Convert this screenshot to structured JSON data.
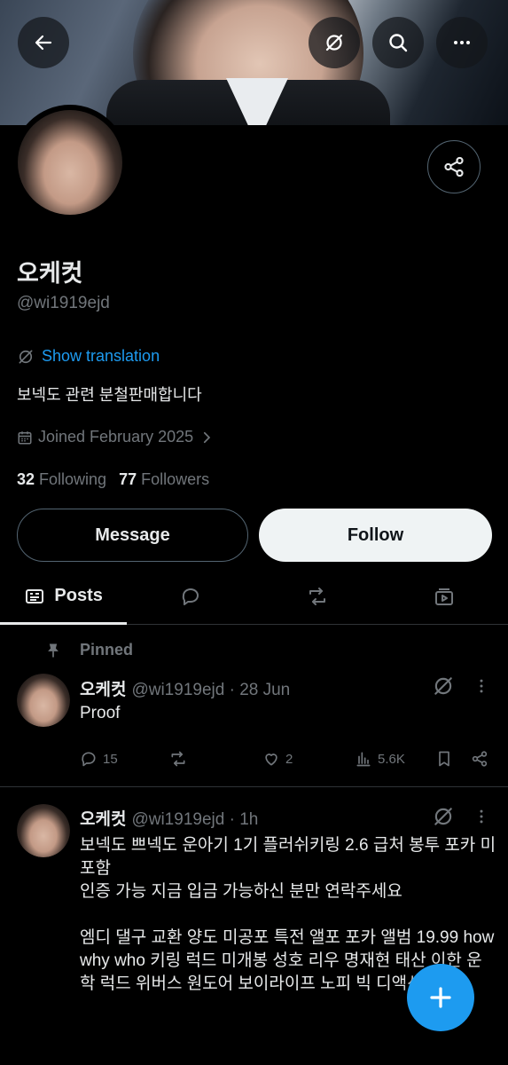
{
  "profile": {
    "name": "오케컷",
    "handle": "@wi1919ejd",
    "show_translation": "Show translation",
    "bio": "보넥도 관련 분철판매합니다",
    "joined": "Joined February 2025",
    "following_count": "32",
    "following_label": "Following",
    "followers_count": "77",
    "followers_label": "Followers"
  },
  "buttons": {
    "message": "Message",
    "follow": "Follow"
  },
  "tabs": {
    "posts": "Posts"
  },
  "pinned_label": "Pinned",
  "posts": [
    {
      "name": "오케컷",
      "meta": "@wi1919ejd · 28 Jun",
      "text": "Proof",
      "replies": "15",
      "reposts": "",
      "likes": "2",
      "views": "5.6K"
    },
    {
      "name": "오케컷",
      "meta": "@wi1919ejd · 1h",
      "text": "보넥도 쁘넥도 운아기 1기 플러쉬키링 2.6 급처 봉투 포카 미포함\n인증 가능 지금 입금 가능하신 분만 연락주세요\n\n엠디 댈구 교환 양도 미공포 특전 앨포 포카 앨범 19.99 how why who 키링 럭드 미개봉 성호 리우 명재현 태산 이한 운학 럭드 위버스 원도어 보이라이프 노피 빅 디액션 viral"
    }
  ],
  "colors": {
    "accent": "#1d9bf0",
    "background": "#000000",
    "text": "#e7e9ea",
    "muted": "#71767b"
  }
}
